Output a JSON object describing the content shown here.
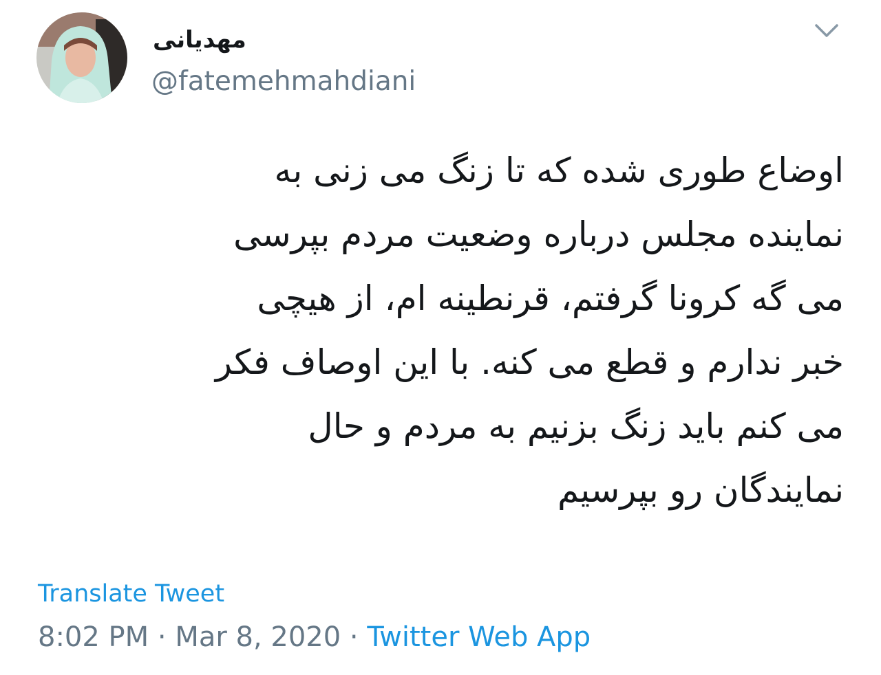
{
  "author": {
    "display_name": "مهدیانی",
    "handle": "@fatemehmahdiani"
  },
  "tweet": {
    "lines": [
      "اوضاع طوری شده که تا زنگ می زنی به",
      "نماینده مجلس درباره وضعیت مردم بپرسی",
      "می گه کرونا گرفتم، قرنطینه ام، از هیچی",
      "خبر ندارم و قطع می کنه. با این اوصاف فکر",
      "می کنم باید زنگ بزنیم به مردم و حال",
      "نمایندگان رو بپرسیم"
    ]
  },
  "translate_label": "Translate Tweet",
  "meta": {
    "time": "8:02 PM",
    "separator": "·",
    "date": "Mar 8, 2020",
    "source": "Twitter Web App"
  },
  "colors": {
    "text": "#14171a",
    "secondary": "#657786",
    "link": "#1b95e0"
  },
  "icons": {
    "menu": "chevron-down-icon",
    "avatar": "avatar"
  }
}
